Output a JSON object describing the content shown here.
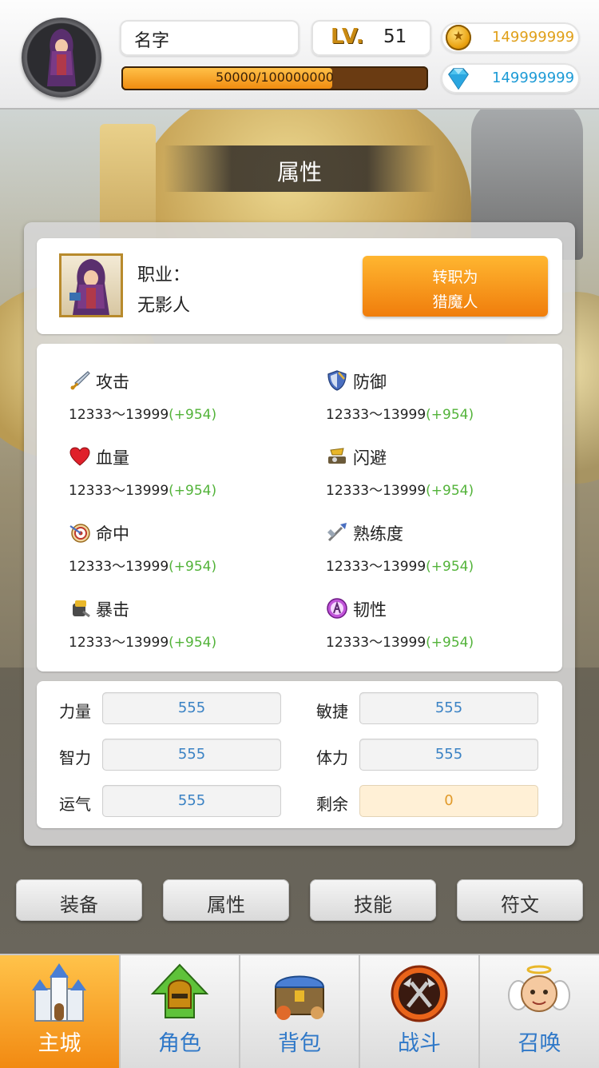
{
  "header": {
    "player_name": "名字",
    "level_label": "LV.",
    "level_value": "51",
    "xp_text": "50000/100000000",
    "xp_fraction": 0.69,
    "gold": "149999999",
    "gems": "149999999"
  },
  "title": "属性",
  "job": {
    "label": "职业：",
    "name": "无影人",
    "change_button_line1": "转职为",
    "change_button_line2": "猎魔人"
  },
  "stats": [
    {
      "name": "攻击",
      "range": "12333～13999",
      "bonus": "(+954)",
      "icon": "sword-icon"
    },
    {
      "name": "防御",
      "range": "12333～13999",
      "bonus": "(+954)",
      "icon": "shield-icon"
    },
    {
      "name": "血量",
      "range": "12333～13999",
      "bonus": "(+954)",
      "icon": "heart-icon"
    },
    {
      "name": "闪避",
      "range": "12333～13999",
      "bonus": "(+954)",
      "icon": "dodge-icon"
    },
    {
      "name": "命中",
      "range": "12333～13999",
      "bonus": "(+954)",
      "icon": "target-icon"
    },
    {
      "name": "熟练度",
      "range": "12333～13999",
      "bonus": "(+954)",
      "icon": "proficiency-icon"
    },
    {
      "name": "暴击",
      "range": "12333～13999",
      "bonus": "(+954)",
      "icon": "critical-icon"
    },
    {
      "name": "韧性",
      "range": "12333～13999",
      "bonus": "(+954)",
      "icon": "toughness-icon"
    }
  ],
  "attributes": [
    {
      "label": "力量",
      "value": "555"
    },
    {
      "label": "敏捷",
      "value": "555"
    },
    {
      "label": "智力",
      "value": "555"
    },
    {
      "label": "体力",
      "value": "555"
    },
    {
      "label": "运气",
      "value": "555"
    },
    {
      "label": "剩余",
      "value": "0"
    }
  ],
  "sub_tabs": [
    "装备",
    "属性",
    "技能",
    "符文"
  ],
  "nav": [
    {
      "label": "主城",
      "icon": "castle-icon",
      "active": true
    },
    {
      "label": "角色",
      "icon": "helmet-icon",
      "active": false
    },
    {
      "label": "背包",
      "icon": "chest-icon",
      "active": false
    },
    {
      "label": "战斗",
      "icon": "battle-axe-icon",
      "active": false
    },
    {
      "label": "召唤",
      "icon": "angel-icon",
      "active": false
    }
  ],
  "colors": {
    "accent_orange": "#f28a12",
    "bonus_green": "#53b33a",
    "value_blue": "#3a82c4",
    "gold_text": "#e0a01a",
    "gem_text": "#1d9bd6"
  }
}
